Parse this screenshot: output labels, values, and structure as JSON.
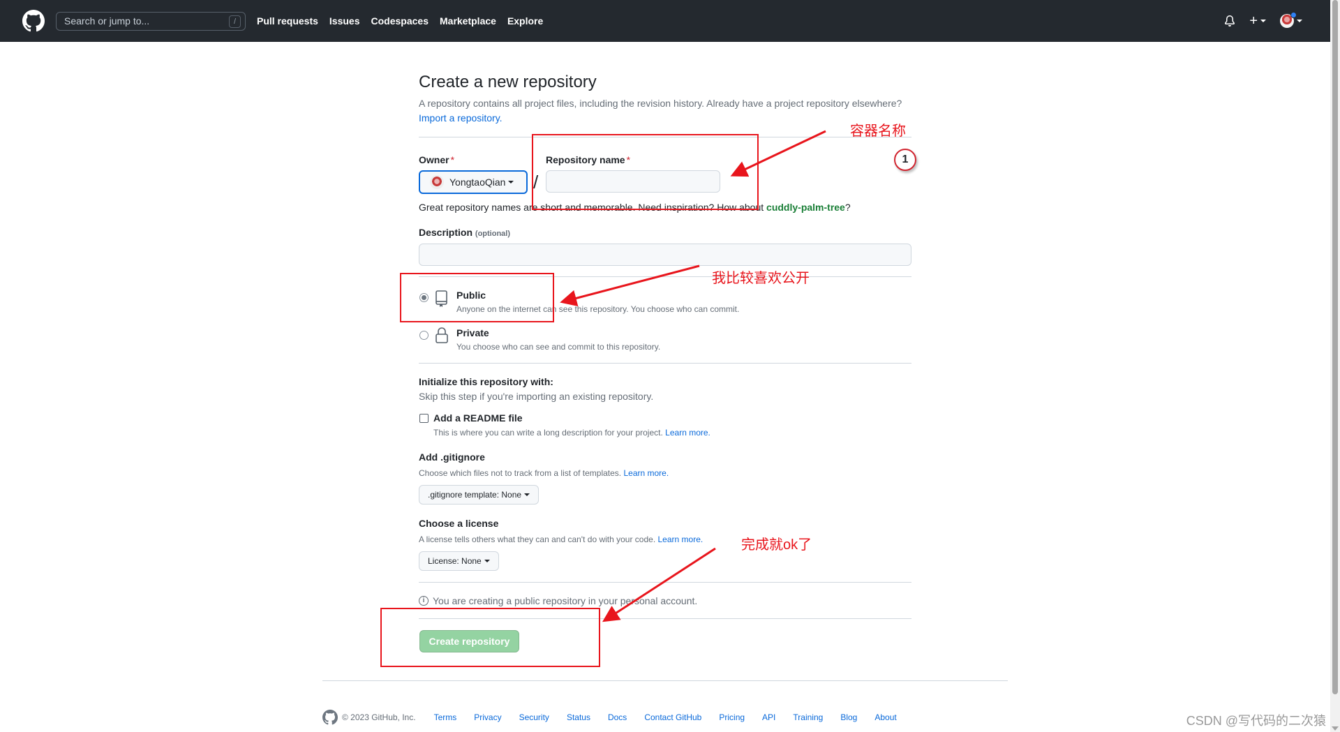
{
  "header": {
    "search_placeholder": "Search or jump to...",
    "search_shortcut": "/",
    "nav": [
      "Pull requests",
      "Issues",
      "Codespaces",
      "Marketplace",
      "Explore"
    ],
    "plus_label": "+"
  },
  "page": {
    "title": "Create a new repository",
    "subtitle": "A repository contains all project files, including the revision history. Already have a project repository elsewhere?",
    "import_link": "Import a repository."
  },
  "form": {
    "owner_label": "Owner",
    "owner_value": "YongtaoQian",
    "separator": "/",
    "repo_label": "Repository name",
    "required_mark": "*",
    "repo_value": "",
    "hint_prefix": "Great repository names are short and memorable. Need inspiration? How about",
    "hint_suggestion": "cuddly-palm-tree",
    "hint_suffix": "?",
    "description_label": "Description",
    "description_optional": "(optional)",
    "description_value": "",
    "visibility": [
      {
        "label": "Public",
        "desc": "Anyone on the internet can see this repository. You choose who can commit.",
        "checked": true
      },
      {
        "label": "Private",
        "desc": "You choose who can see and commit to this repository.",
        "checked": false
      }
    ],
    "init_title": "Initialize this repository with:",
    "init_subtitle": "Skip this step if you're importing an existing repository.",
    "readme_label": "Add a README file",
    "readme_desc": "This is where you can write a long description for your project.",
    "learn_more": "Learn more.",
    "gitignore_title": "Add .gitignore",
    "gitignore_desc": "Choose which files not to track from a list of templates.",
    "gitignore_button": ".gitignore template: None",
    "license_title": "Choose a license",
    "license_desc": "A license tells others what they can and can't do with your code.",
    "license_button": "License: None",
    "info_text": "You are creating a public repository in your personal account.",
    "create_button": "Create repository"
  },
  "annotations": {
    "repo_name_note": "容器名称",
    "public_note": "我比较喜欢公开",
    "done_note": "完成就ok了",
    "step_number": "1",
    "accent_color": "#e8151c"
  },
  "footer": {
    "copyright": "© 2023 GitHub, Inc.",
    "links": [
      "Terms",
      "Privacy",
      "Security",
      "Status",
      "Docs",
      "Contact GitHub",
      "Pricing",
      "API",
      "Training",
      "Blog",
      "About"
    ]
  },
  "watermark": "CSDN @写代码的二次猿"
}
